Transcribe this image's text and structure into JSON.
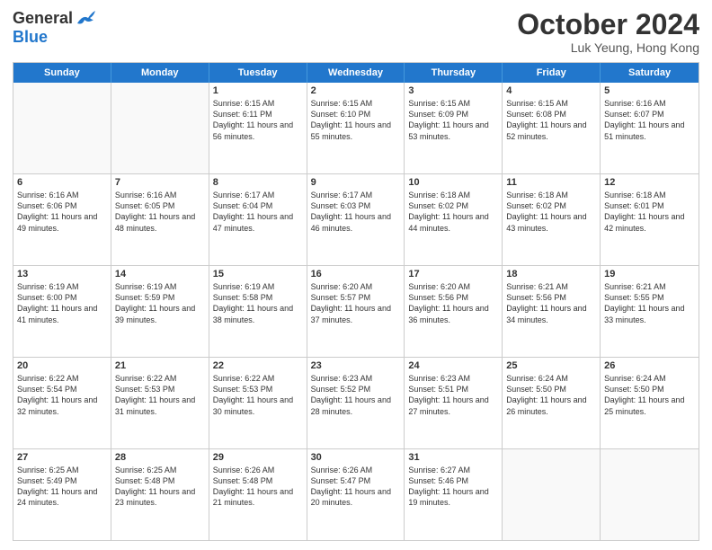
{
  "header": {
    "logo_general": "General",
    "logo_blue": "Blue",
    "month_title": "October 2024",
    "subtitle": "Luk Yeung, Hong Kong"
  },
  "days_of_week": [
    "Sunday",
    "Monday",
    "Tuesday",
    "Wednesday",
    "Thursday",
    "Friday",
    "Saturday"
  ],
  "weeks": [
    [
      {
        "day": "",
        "empty": true
      },
      {
        "day": "",
        "empty": true
      },
      {
        "day": "1",
        "sunrise": "Sunrise: 6:15 AM",
        "sunset": "Sunset: 6:11 PM",
        "daylight": "Daylight: 11 hours and 56 minutes."
      },
      {
        "day": "2",
        "sunrise": "Sunrise: 6:15 AM",
        "sunset": "Sunset: 6:10 PM",
        "daylight": "Daylight: 11 hours and 55 minutes."
      },
      {
        "day": "3",
        "sunrise": "Sunrise: 6:15 AM",
        "sunset": "Sunset: 6:09 PM",
        "daylight": "Daylight: 11 hours and 53 minutes."
      },
      {
        "day": "4",
        "sunrise": "Sunrise: 6:15 AM",
        "sunset": "Sunset: 6:08 PM",
        "daylight": "Daylight: 11 hours and 52 minutes."
      },
      {
        "day": "5",
        "sunrise": "Sunrise: 6:16 AM",
        "sunset": "Sunset: 6:07 PM",
        "daylight": "Daylight: 11 hours and 51 minutes."
      }
    ],
    [
      {
        "day": "6",
        "sunrise": "Sunrise: 6:16 AM",
        "sunset": "Sunset: 6:06 PM",
        "daylight": "Daylight: 11 hours and 49 minutes."
      },
      {
        "day": "7",
        "sunrise": "Sunrise: 6:16 AM",
        "sunset": "Sunset: 6:05 PM",
        "daylight": "Daylight: 11 hours and 48 minutes."
      },
      {
        "day": "8",
        "sunrise": "Sunrise: 6:17 AM",
        "sunset": "Sunset: 6:04 PM",
        "daylight": "Daylight: 11 hours and 47 minutes."
      },
      {
        "day": "9",
        "sunrise": "Sunrise: 6:17 AM",
        "sunset": "Sunset: 6:03 PM",
        "daylight": "Daylight: 11 hours and 46 minutes."
      },
      {
        "day": "10",
        "sunrise": "Sunrise: 6:18 AM",
        "sunset": "Sunset: 6:02 PM",
        "daylight": "Daylight: 11 hours and 44 minutes."
      },
      {
        "day": "11",
        "sunrise": "Sunrise: 6:18 AM",
        "sunset": "Sunset: 6:02 PM",
        "daylight": "Daylight: 11 hours and 43 minutes."
      },
      {
        "day": "12",
        "sunrise": "Sunrise: 6:18 AM",
        "sunset": "Sunset: 6:01 PM",
        "daylight": "Daylight: 11 hours and 42 minutes."
      }
    ],
    [
      {
        "day": "13",
        "sunrise": "Sunrise: 6:19 AM",
        "sunset": "Sunset: 6:00 PM",
        "daylight": "Daylight: 11 hours and 41 minutes."
      },
      {
        "day": "14",
        "sunrise": "Sunrise: 6:19 AM",
        "sunset": "Sunset: 5:59 PM",
        "daylight": "Daylight: 11 hours and 39 minutes."
      },
      {
        "day": "15",
        "sunrise": "Sunrise: 6:19 AM",
        "sunset": "Sunset: 5:58 PM",
        "daylight": "Daylight: 11 hours and 38 minutes."
      },
      {
        "day": "16",
        "sunrise": "Sunrise: 6:20 AM",
        "sunset": "Sunset: 5:57 PM",
        "daylight": "Daylight: 11 hours and 37 minutes."
      },
      {
        "day": "17",
        "sunrise": "Sunrise: 6:20 AM",
        "sunset": "Sunset: 5:56 PM",
        "daylight": "Daylight: 11 hours and 36 minutes."
      },
      {
        "day": "18",
        "sunrise": "Sunrise: 6:21 AM",
        "sunset": "Sunset: 5:56 PM",
        "daylight": "Daylight: 11 hours and 34 minutes."
      },
      {
        "day": "19",
        "sunrise": "Sunrise: 6:21 AM",
        "sunset": "Sunset: 5:55 PM",
        "daylight": "Daylight: 11 hours and 33 minutes."
      }
    ],
    [
      {
        "day": "20",
        "sunrise": "Sunrise: 6:22 AM",
        "sunset": "Sunset: 5:54 PM",
        "daylight": "Daylight: 11 hours and 32 minutes."
      },
      {
        "day": "21",
        "sunrise": "Sunrise: 6:22 AM",
        "sunset": "Sunset: 5:53 PM",
        "daylight": "Daylight: 11 hours and 31 minutes."
      },
      {
        "day": "22",
        "sunrise": "Sunrise: 6:22 AM",
        "sunset": "Sunset: 5:53 PM",
        "daylight": "Daylight: 11 hours and 30 minutes."
      },
      {
        "day": "23",
        "sunrise": "Sunrise: 6:23 AM",
        "sunset": "Sunset: 5:52 PM",
        "daylight": "Daylight: 11 hours and 28 minutes."
      },
      {
        "day": "24",
        "sunrise": "Sunrise: 6:23 AM",
        "sunset": "Sunset: 5:51 PM",
        "daylight": "Daylight: 11 hours and 27 minutes."
      },
      {
        "day": "25",
        "sunrise": "Sunrise: 6:24 AM",
        "sunset": "Sunset: 5:50 PM",
        "daylight": "Daylight: 11 hours and 26 minutes."
      },
      {
        "day": "26",
        "sunrise": "Sunrise: 6:24 AM",
        "sunset": "Sunset: 5:50 PM",
        "daylight": "Daylight: 11 hours and 25 minutes."
      }
    ],
    [
      {
        "day": "27",
        "sunrise": "Sunrise: 6:25 AM",
        "sunset": "Sunset: 5:49 PM",
        "daylight": "Daylight: 11 hours and 24 minutes."
      },
      {
        "day": "28",
        "sunrise": "Sunrise: 6:25 AM",
        "sunset": "Sunset: 5:48 PM",
        "daylight": "Daylight: 11 hours and 23 minutes."
      },
      {
        "day": "29",
        "sunrise": "Sunrise: 6:26 AM",
        "sunset": "Sunset: 5:48 PM",
        "daylight": "Daylight: 11 hours and 21 minutes."
      },
      {
        "day": "30",
        "sunrise": "Sunrise: 6:26 AM",
        "sunset": "Sunset: 5:47 PM",
        "daylight": "Daylight: 11 hours and 20 minutes."
      },
      {
        "day": "31",
        "sunrise": "Sunrise: 6:27 AM",
        "sunset": "Sunset: 5:46 PM",
        "daylight": "Daylight: 11 hours and 19 minutes."
      },
      {
        "day": "",
        "empty": true
      },
      {
        "day": "",
        "empty": true
      }
    ]
  ]
}
